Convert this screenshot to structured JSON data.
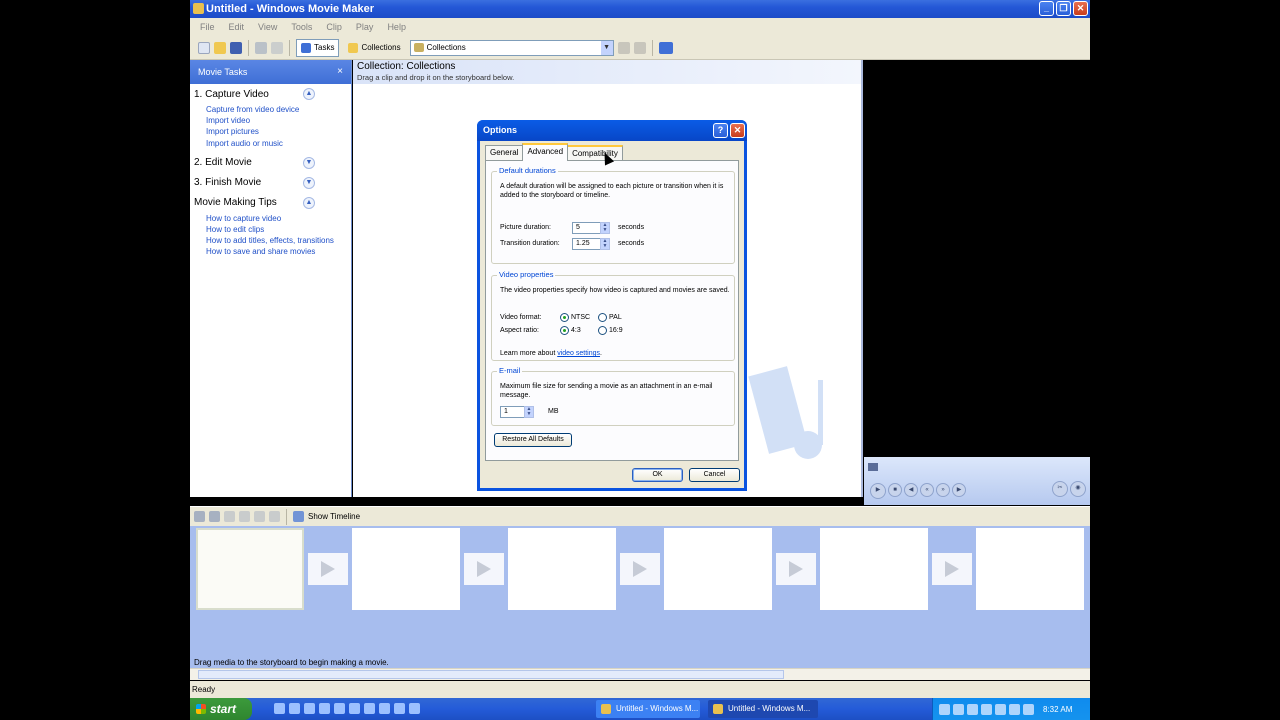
{
  "window": {
    "title": "Untitled - Windows Movie Maker"
  },
  "menu": [
    "File",
    "Edit",
    "View",
    "Tools",
    "Clip",
    "Play",
    "Help"
  ],
  "toolbar": {
    "tasks_label": "Tasks",
    "collections_label": "Collections",
    "combo_value": "Collections"
  },
  "task_pane": {
    "header": "Movie Tasks",
    "close": "×",
    "sections": [
      {
        "title": "1. Capture Video",
        "expanded": true,
        "links": [
          "Capture from video device",
          "Import video",
          "Import pictures",
          "Import audio or music"
        ]
      },
      {
        "title": "2. Edit Movie",
        "expanded": false,
        "links": []
      },
      {
        "title": "3. Finish Movie",
        "expanded": false,
        "links": []
      },
      {
        "title": "Movie Making Tips",
        "expanded": true,
        "links": [
          "How to capture video",
          "How to edit clips",
          "How to add titles, effects, transitions",
          "How to save and share movies"
        ]
      }
    ]
  },
  "collection": {
    "title": "Collection: Collections",
    "subtitle": "Drag a clip and drop it on the storyboard below."
  },
  "dialog": {
    "title": "Options",
    "help_btn": "?",
    "close_btn": "✕",
    "tabs": [
      "General",
      "Advanced",
      "Compatibility"
    ],
    "active_tab": "Advanced",
    "default_durations": {
      "title": "Default durations",
      "desc": "A default duration will be assigned to each picture or transition when it is added to the storyboard or timeline.",
      "picture_label": "Picture duration:",
      "picture_value": "5",
      "transition_label": "Transition duration:",
      "transition_value": "1.25",
      "unit": "seconds"
    },
    "video_properties": {
      "title": "Video properties",
      "desc": "The video properties specify how video is captured and movies are saved.",
      "format_label": "Video format:",
      "format_options": [
        "NTSC",
        "PAL"
      ],
      "format_selected": "NTSC",
      "aspect_label": "Aspect ratio:",
      "aspect_options": [
        "4:3",
        "16:9"
      ],
      "aspect_selected": "4:3",
      "learn_more_prefix": "Learn more about",
      "learn_more_link": "video settings",
      "learn_more_suffix": "."
    },
    "email": {
      "title": "E-mail",
      "desc": "Maximum file size for sending a movie as an attachment in an e-mail message.",
      "value": "1",
      "unit": "MB"
    },
    "restore_button": "Restore All Defaults",
    "ok_button": "OK",
    "cancel_button": "Cancel"
  },
  "storyboard": {
    "show_timeline_label": "Show Timeline",
    "hint": "Drag media to the storyboard to begin making a movie."
  },
  "status": {
    "text": "Ready"
  },
  "taskbar": {
    "start_label": "start",
    "buttons": [
      "Untitled - Windows M...",
      "Untitled - Windows M..."
    ],
    "clock": "8:32 AM"
  }
}
